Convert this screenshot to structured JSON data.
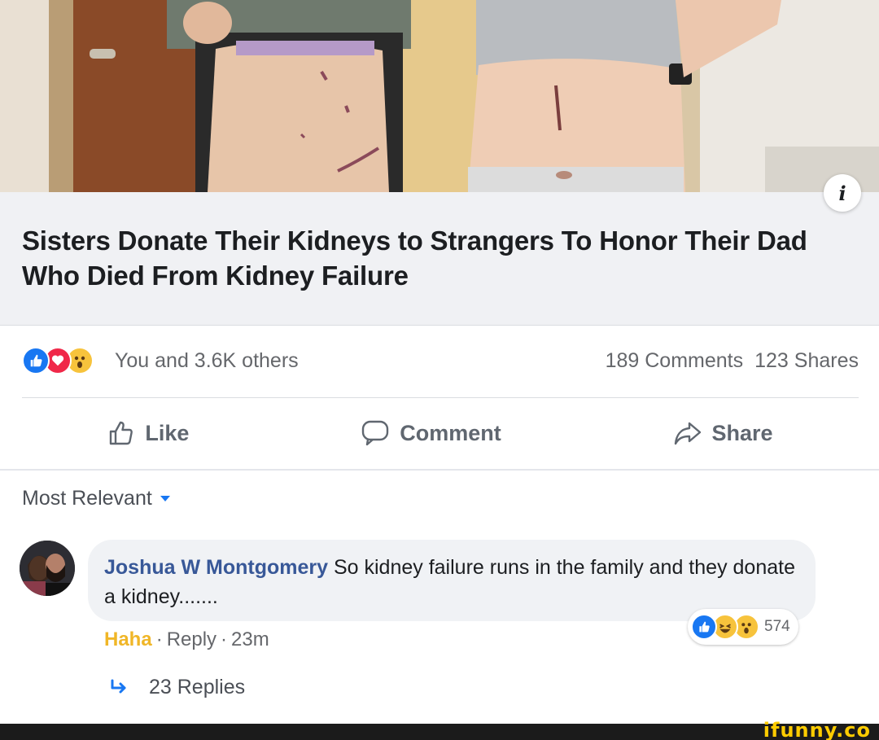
{
  "post": {
    "headline": "Sisters Donate Their Kidneys to Strangers To Honor Their Dad Who Died From Kidney Failure",
    "info_glyph": "i"
  },
  "stats": {
    "reactions_text": "You and 3.6K others",
    "comments": "189 Comments",
    "shares": "123 Shares",
    "reaction_icons": [
      "like-icon",
      "love-icon",
      "wow-icon"
    ]
  },
  "actions": {
    "like": "Like",
    "comment": "Comment",
    "share": "Share"
  },
  "comments_section": {
    "sort_label": "Most Relevant",
    "comment": {
      "author": "Joshua W Montgomery",
      "text": "So kidney failure runs in the family and they donate a kidney.......",
      "reaction_label": "Haha",
      "reply_label": "Reply",
      "time": "23m",
      "reaction_count": "574",
      "reaction_icons": [
        "like-icon",
        "haha-icon",
        "wow-icon"
      ]
    },
    "replies_label": "23 Replies"
  },
  "watermark": {
    "text": "ifunny.co"
  },
  "colors": {
    "link_blue": "#385898",
    "like_blue": "#1877f2",
    "love_red": "#f02849",
    "wow_yellow": "#f7c33c",
    "haha_label": "#f0b627",
    "watermark_yellow": "#ffcc00"
  }
}
